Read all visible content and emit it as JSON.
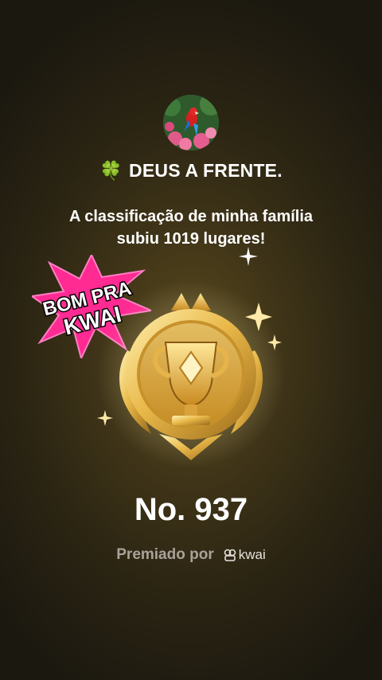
{
  "profile": {
    "avatar_icon": "parrot-flowers-avatar",
    "name": "DEUS A FRENTE.",
    "name_prefix_icon": "four-leaf-clover-icon"
  },
  "message": {
    "line1": "A classificação de minha família",
    "line2": "subiu 1019 lugares!"
  },
  "sticker": {
    "line1": "BOM PRA",
    "line2": "KWAI",
    "color": "#ff1f8e"
  },
  "trophy": {
    "icon": "gold-trophy-medal-icon"
  },
  "rank": {
    "text": "No. 937"
  },
  "awarded": {
    "label": "Premiado por",
    "brand": "kwai"
  },
  "colors": {
    "background": "#3f3418",
    "gold": "#e8bf52"
  }
}
